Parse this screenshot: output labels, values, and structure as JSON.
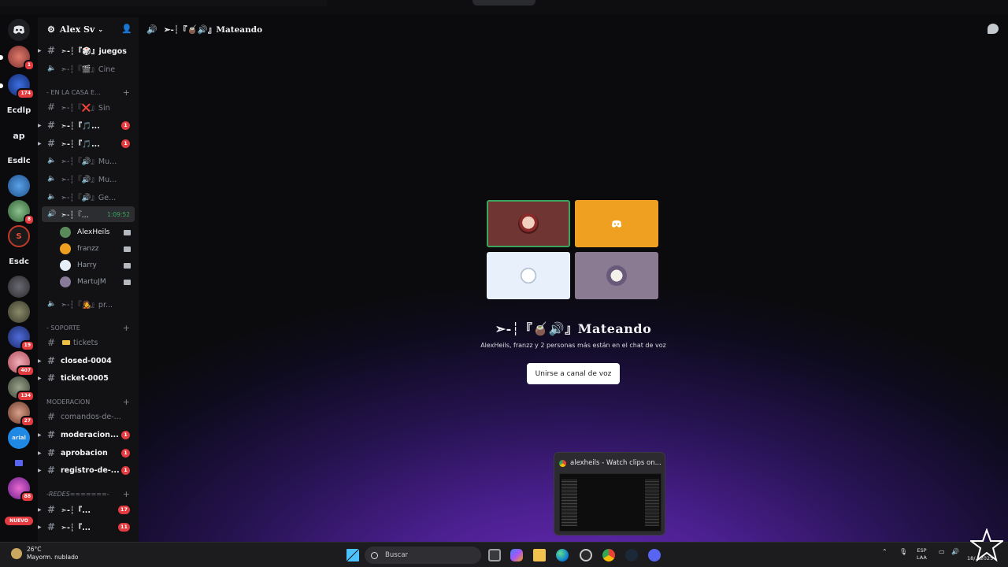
{
  "server": {
    "name": "Alex Sv",
    "rail": [
      {
        "label": "",
        "badge": "1"
      },
      {
        "label": "",
        "badge": "174"
      },
      {
        "label": "Ecdlp",
        "badge": ""
      },
      {
        "label": "ap",
        "badge": ""
      },
      {
        "label": "Esdlc",
        "badge": ""
      },
      {
        "label": "",
        "badge": ""
      },
      {
        "label": "",
        "badge": "8"
      },
      {
        "label": "",
        "badge": ""
      },
      {
        "label": "Esdc",
        "badge": ""
      },
      {
        "label": "",
        "badge": ""
      },
      {
        "label": "",
        "badge": ""
      },
      {
        "label": "",
        "badge": "19"
      },
      {
        "label": "",
        "badge": "407"
      },
      {
        "label": "",
        "badge": "134"
      },
      {
        "label": "",
        "badge": "27"
      },
      {
        "label": "",
        "badge": ""
      },
      {
        "label": "",
        "badge": ""
      },
      {
        "label": "",
        "badge": "88"
      }
    ],
    "nuevo_label": "NUEVO"
  },
  "channels": {
    "ch1": "➣-┆『🎲』juegos",
    "ch2": "➣-┆『🎬』Cine",
    "cat1": "- EN LA CASA E...",
    "ch3": "➣-┆『❌』Sin",
    "ch4": "➣-┆『🎵...",
    "ch4_count": "1",
    "ch5": "➣-┆『🎵...",
    "ch5_count": "1",
    "ch6": "➣-┆『🔊』Mu...",
    "ch7": "➣-┆『🔊』Mu...",
    "ch8": "➣-┆『🔊』Ge...",
    "active": "➣-┆『...",
    "active_timer": "1:09:52",
    "members": [
      {
        "name": "AlexHeils"
      },
      {
        "name": "franzz"
      },
      {
        "name": "Harry"
      },
      {
        "name": "MartuJM"
      }
    ],
    "ch9": "➣-┆『🧑‍🎤』pr...",
    "cat2": "- SOPORTE",
    "tickets": "tickets",
    "closed": "closed-0004",
    "ticket5": "ticket-0005",
    "cat3": "MODERACION",
    "comandos": "comandos-de-...",
    "moderacion": "moderacion...",
    "moderacion_count": "1",
    "aprobacion": "aprobacion",
    "aprobacion_count": "1",
    "registro": "registro-de-...",
    "registro_count": "1",
    "cat4": "-REDES=======-",
    "ch10": "➣-┆『...",
    "ch10_count": "17",
    "ch11": "➣-┆『...",
    "ch11_count": "11"
  },
  "main": {
    "header": "➣-┆『🧉🔊』Mateando",
    "voice_title": "➣-┆『🧉🔊』Mateando",
    "voice_sub": "AlexHeils, franzz y 2 personas más están en el chat de voz",
    "join_label": "Unirse a canal de voz"
  },
  "preview": {
    "title": "alexheils - Watch clips on..."
  },
  "taskbar": {
    "weather_temp": "26°C",
    "weather_desc": "Mayorm. nublado",
    "search_placeholder": "Buscar",
    "lang1": "ESP",
    "lang2": "LAA",
    "date": "18/...2025"
  },
  "colors": {
    "accent_red": "#e23c40",
    "voice_green": "#3ba55d",
    "gradient_purple": "#6a2bb8"
  }
}
